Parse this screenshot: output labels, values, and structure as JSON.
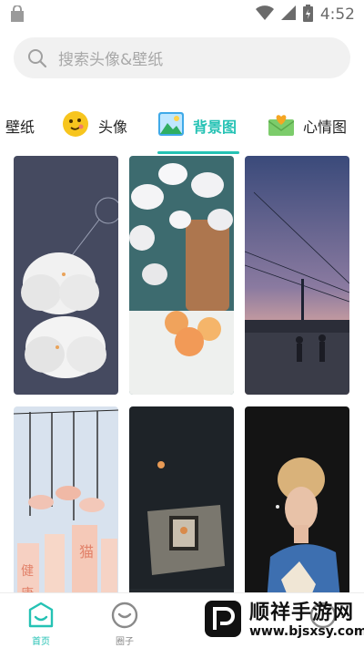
{
  "status_bar": {
    "time": "4:52"
  },
  "search": {
    "placeholder": "搜索头像&壁纸"
  },
  "tabs": [
    {
      "label": "壁纸"
    },
    {
      "label": "头像"
    },
    {
      "label": "背景图",
      "active": true
    },
    {
      "label": "心情图"
    }
  ],
  "grid": {
    "items": [
      {
        "title": "ducks-cloud-wallpaper"
      },
      {
        "title": "orchid-peaches-wallpaper"
      },
      {
        "title": "street-dusk-wallpaper"
      },
      {
        "title": "wind-chimes-wallpaper",
        "text": [
          "猫",
          "健",
          "康"
        ]
      },
      {
        "title": "dark-room-light-wallpaper"
      },
      {
        "title": "portrait-man-wallpaper"
      }
    ]
  },
  "bottom_nav": {
    "items": [
      {
        "label": "首页",
        "active": true
      },
      {
        "label": "圈子"
      },
      {
        "label": ""
      },
      {
        "label": ""
      }
    ]
  },
  "watermark": {
    "name": "顺祥手游网",
    "url": "www.bjsxsy.com"
  },
  "colors": {
    "accent": "#25c2b4",
    "search_bg": "#f1f1f1"
  }
}
